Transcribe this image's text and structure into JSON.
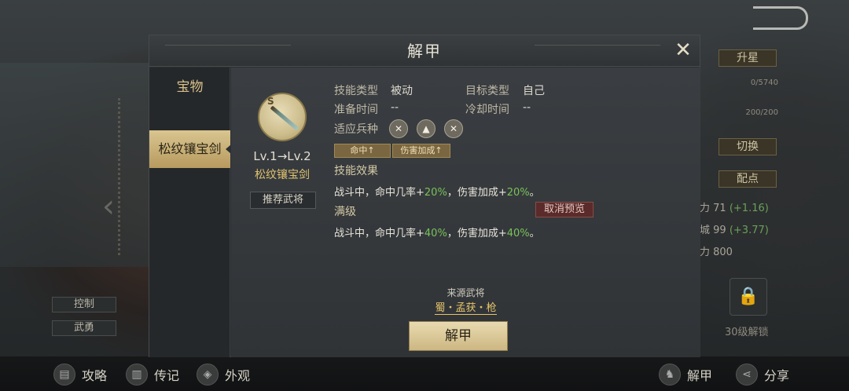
{
  "dialog": {
    "title": "解甲",
    "close_icon": "✕",
    "sidebar": {
      "heading": "宝物",
      "tab_label": "松纹镶宝剑"
    },
    "item": {
      "level_text": "Lv.1→Lv.2",
      "name": "松纹镶宝剑",
      "recommend_label": "推荐武将",
      "rank_letter": "S"
    },
    "info": {
      "skill_type_label": "技能类型",
      "skill_type_value": "被动",
      "target_type_label": "目标类型",
      "target_type_value": "自己",
      "prepare_time_label": "准备时间",
      "prepare_time_value": "--",
      "cooldown_label": "冷却时间",
      "cooldown_value": "--",
      "troop_label": "适应兵种",
      "troop_icons": [
        "✕",
        "▲",
        "✕"
      ]
    },
    "tags": [
      "命中↑",
      "伤害加成↑"
    ],
    "effect": {
      "title": "技能效果",
      "line_a": "战斗中，命中几率+",
      "val_a": "20%",
      "line_b": "，伤害加成+",
      "val_b": "20%",
      "line_end": "。"
    },
    "max_level": {
      "title": "满级",
      "cancel_preview_label": "取消预览",
      "line_a": "战斗中，命中几率+",
      "val_a": "40%",
      "line_b": "，伤害加成+",
      "val_b": "40%",
      "line_end": "。"
    },
    "source": {
      "label": "来源武将",
      "link": "蜀・孟获・枪"
    },
    "action_button": "解甲"
  },
  "background": {
    "left_tags": [
      "控制",
      "武勇"
    ],
    "right_buttons": [
      "升星",
      "切换",
      "配点"
    ],
    "bars": [
      "0/5740",
      "200/200"
    ],
    "stats": [
      {
        "text": "力 71",
        "bonus": "(+1.16)"
      },
      {
        "text": "城 99",
        "bonus": "(+3.77)"
      },
      {
        "text": "力 800",
        "bonus": ""
      }
    ],
    "lock_label": "30级解锁"
  },
  "bottom_bar": {
    "items": [
      "攻略",
      "传记",
      "外观",
      "解甲",
      "分享"
    ]
  },
  "colors": {
    "accent_gold": "#e0c270",
    "green_value": "#7ac25a",
    "panel_bg": "#2c3034"
  }
}
